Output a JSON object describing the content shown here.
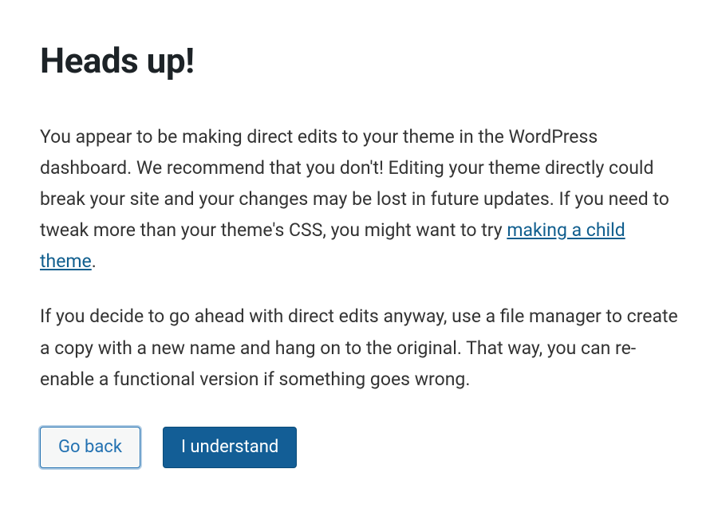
{
  "dialog": {
    "heading": "Heads up!",
    "paragraph1_before_link": "You appear to be making direct edits to your theme in the WordPress dashboard. We recommend that you don't! Editing your theme directly could break your site and your changes may be lost in future updates. If you need to tweak more than your theme's CSS, you might want to try ",
    "link_text": "making a child theme",
    "paragraph1_after_link": ".",
    "paragraph2": "If you decide to go ahead with direct edits anyway, use a file manager to create a copy with a new name and hang on to the original. That way, you can re-enable a functional version if something goes wrong.",
    "go_back_label": "Go back",
    "understand_label": "I understand"
  }
}
